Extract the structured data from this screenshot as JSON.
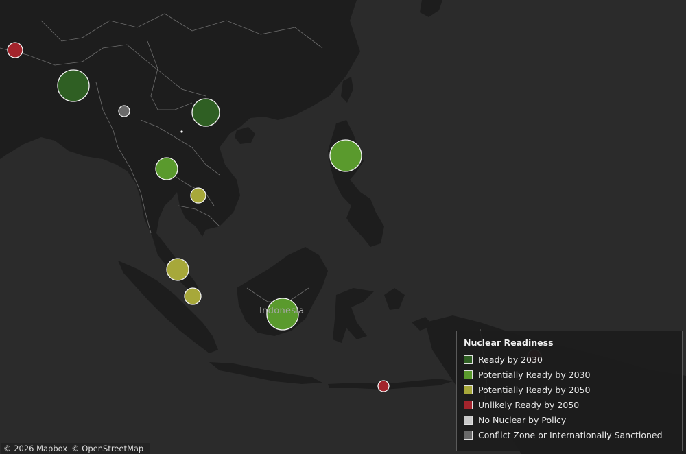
{
  "legend": {
    "title": "Nuclear Readiness",
    "items": [
      {
        "label": "Ready by 2030",
        "color": "#2f5f23"
      },
      {
        "label": "Potentially Ready by 2030",
        "color": "#5a9a2d"
      },
      {
        "label": "Potentially Ready by 2050",
        "color": "#a7a83a"
      },
      {
        "label": "Unlikely Ready by 2050",
        "color": "#a3242c"
      },
      {
        "label": "No Nuclear by Policy",
        "color": "#c8c8c8"
      },
      {
        "label": "Conflict Zone or Internationally Sanctioned",
        "color": "#6a6a6a"
      }
    ]
  },
  "map_labels": {
    "indonesia": "Indonesia"
  },
  "attribution": {
    "mapbox": "© 2026 Mapbox",
    "osm": "© OpenStreetMap"
  },
  "colors": {
    "ocean": "#2b2b2b",
    "land": "#1e1e1e",
    "borders": "#8a8a8a"
  }
}
